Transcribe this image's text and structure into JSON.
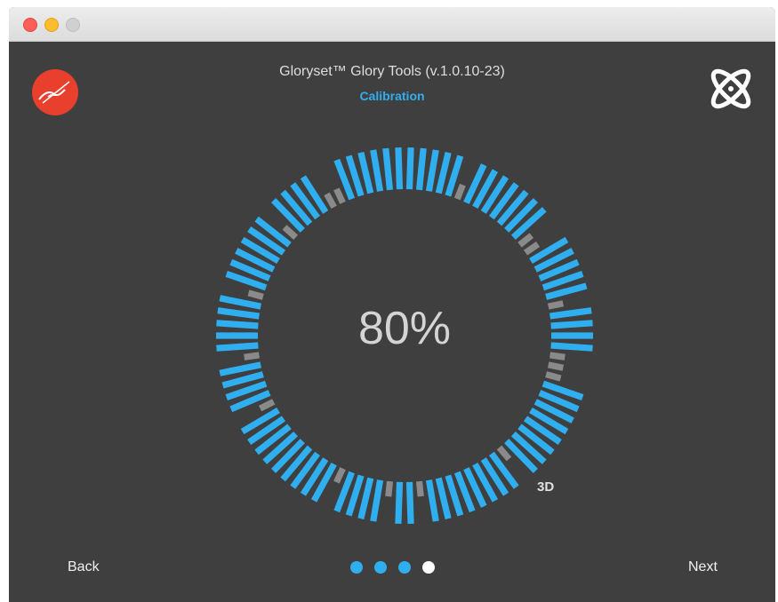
{
  "window": {
    "buttons": [
      "close",
      "minimize",
      "zoom"
    ]
  },
  "header": {
    "title": "Gloryset™ Glory Tools (v.1.0.10-23)",
    "subtitle": "Calibration",
    "logo_icon": "brand-logo-icon",
    "mode_icon": "orbit-icon"
  },
  "progress": {
    "label": "80%",
    "value": 0.8,
    "mode": "3D"
  },
  "ring": {
    "segment_states": [
      1,
      1,
      1,
      1,
      1,
      0,
      1,
      1,
      1,
      1,
      1,
      1,
      1,
      0,
      0,
      1,
      1,
      1,
      1,
      1,
      0,
      1,
      1,
      1,
      1,
      0,
      0,
      0,
      1,
      1,
      1,
      1,
      1,
      1,
      1,
      1,
      0,
      1,
      1,
      1,
      1,
      1,
      1,
      1,
      1,
      0,
      1,
      1,
      0,
      1,
      1,
      1,
      1,
      0,
      1,
      1,
      1,
      1,
      1,
      1,
      1,
      1,
      1,
      0,
      1,
      1,
      1,
      1,
      0,
      1,
      1,
      1,
      1,
      1,
      0,
      1,
      1,
      1,
      1,
      1,
      1,
      0,
      1,
      1,
      1,
      1,
      0,
      0,
      1,
      1,
      1,
      1,
      1,
      1
    ],
    "active_color": "#30aff0",
    "inactive_color": "#8a8a8a"
  },
  "footer": {
    "back_label": "Back",
    "next_label": "Next",
    "steps_total": 4,
    "current_step": 4
  },
  "colors": {
    "background": "#3f3f3f",
    "accent": "#30aff0",
    "logo_red": "#e8402c"
  }
}
